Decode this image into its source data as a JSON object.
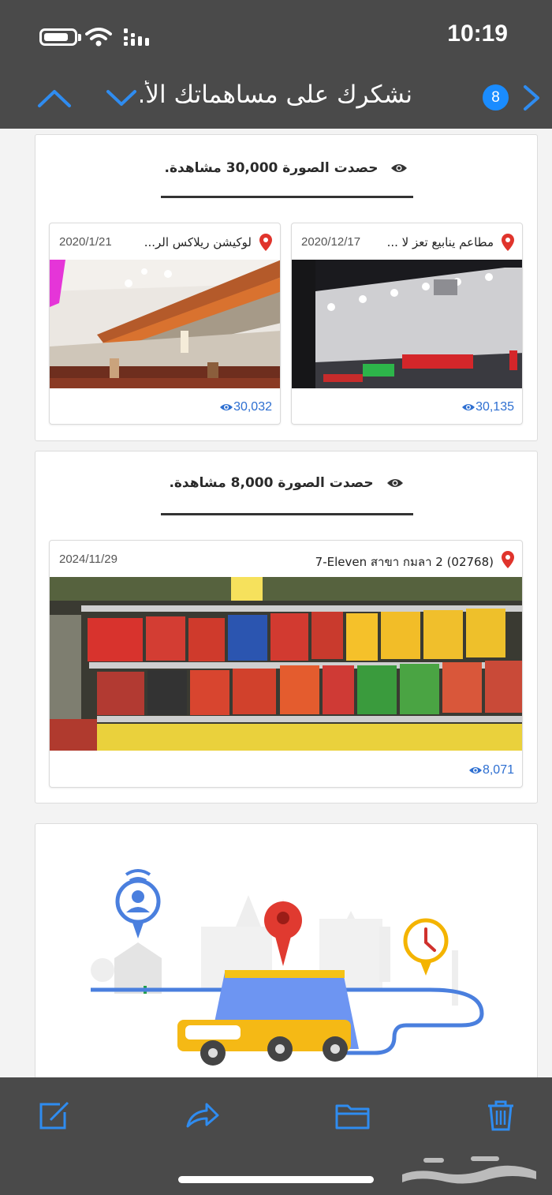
{
  "status_bar": {
    "time": "10:19"
  },
  "nav": {
    "title": "نشكرك على مساهماتك الأ...",
    "badge": "8",
    "icons": [
      "chevron-up-icon",
      "chevron-down-icon",
      "chevron-right-icon"
    ]
  },
  "sections": [
    {
      "heading": "حصدت الصورة 30,000 مشاهدة.",
      "photos": [
        {
          "title": "مطاعم ينابيع تعز لا ...",
          "date": "2020/12/17",
          "views": "30,135"
        },
        {
          "title": "لوكيشن ريلاكس الر...",
          "date": "2020/1/21",
          "views": "30,032"
        }
      ]
    },
    {
      "heading": "حصدت الصورة 8,000 مشاهدة.",
      "photos": [
        {
          "title": "7-Eleven สาขา กมลา 2 (02768)",
          "date": "2024/11/29",
          "views": "8,071"
        }
      ]
    }
  ],
  "toolbar": {
    "icons": [
      "compose-icon",
      "reply-icon",
      "folder-icon",
      "trash-icon"
    ]
  },
  "colors": {
    "bar": "#4a4a4a",
    "accent": "#2f8cf0",
    "link_blue": "#2e6fd1",
    "pin_red": "#e0342c"
  },
  "watermark": "حراج"
}
